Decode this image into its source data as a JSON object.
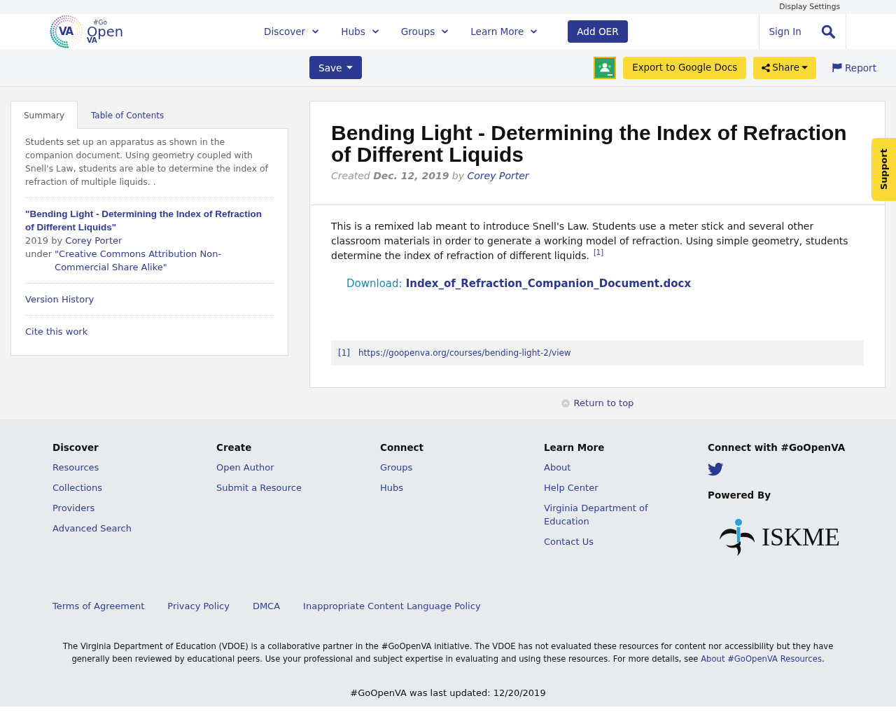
{
  "top_bar": {
    "link": "Display Settings"
  },
  "nav": {
    "logo": {
      "badge": "VA",
      "small_top": "#Go",
      "main": "Open",
      "small_bottom": "VA"
    },
    "items": [
      {
        "label": "Discover"
      },
      {
        "label": "Hubs"
      },
      {
        "label": "Groups"
      },
      {
        "label": "Learn More"
      }
    ],
    "action_button": "Add OER",
    "sign_in": "Sign In"
  },
  "toolbar": {
    "save": "Save",
    "export": "Export to Google Docs",
    "share": "Share",
    "report": "Report"
  },
  "sidebar": {
    "tabs": [
      {
        "label": "Summary",
        "selected": true
      },
      {
        "label": "Table of Contents",
        "selected": false
      }
    ],
    "summary": "Students set up an apparatus as shown in the companion document. Using geometry coupled with Snell's Law, students are able to determine the index of refraction of multiple liquids. .",
    "attribution": {
      "title": "\"Bending Light - Determining the Index of Refraction of Different Liquids\"",
      "year_by": "2019 by",
      "author": "Corey Porter",
      "under": "under",
      "license": "\"Creative Commons Attribution Non-Commercial Share Alike\""
    },
    "links": [
      "Version History",
      "Cite this work"
    ]
  },
  "resource": {
    "title": "Bending Light - Determining the Index of Refraction of Different Liquids",
    "meta": "Created **Dec. 12, 2019** by",
    "author": "Corey Porter",
    "description": "This is a remixed lab meant to introduce Snell's Law. Students use a meter stick and several other classroom materials in order to generate a working model of refraction. Using simple geometry, students determine the index of refraction of different liquids.",
    "reference_mark": "[1]",
    "download_label": "Download:",
    "download_file": "Index_of_Refraction_Companion_Document.docx",
    "footnotes": [
      {
        "mark": "[1]",
        "url": "https://goopenva.org/courses/bending-light-2/view"
      }
    ]
  },
  "support_tab": "Support",
  "return_to_top": "Return to top",
  "footer": {
    "columns": [
      {
        "heading": "Discover",
        "links": [
          "Resources",
          "Collections",
          "Providers",
          "Advanced Search"
        ]
      },
      {
        "heading": "Create",
        "links": [
          "Open Author",
          "Submit a Resource"
        ]
      },
      {
        "heading": "Connect",
        "links": [
          "Groups",
          "Hubs"
        ]
      },
      {
        "heading": "Learn More",
        "links": [
          "About",
          "Help Center",
          "Virginia Department of Education",
          "Contact Us"
        ]
      }
    ],
    "social": {
      "heading": "Connect with #GoOpenVA"
    },
    "powered_by": {
      "heading": "Powered By",
      "logo_text": "ISKME"
    },
    "bottom_links": [
      "Terms of Agreement",
      "Privacy Policy",
      "DMCA",
      "Inappropriate Content Language Policy"
    ],
    "disclaimer": {
      "text": "The Virginia Department of Education (VDOE) is a collaborative partner in the #GoOpenVA initiative. The VDOE has not evaluated these resources for content nor accessibility but they have generally been reviewed by educational peers. Use your professional and subject expertise in evaluating and using these resources. For more details, see",
      "link": "About #GoOpenVA Resources",
      "end": "."
    },
    "last_updated": "#GoOpenVA was last updated: 12/20/2019"
  }
}
